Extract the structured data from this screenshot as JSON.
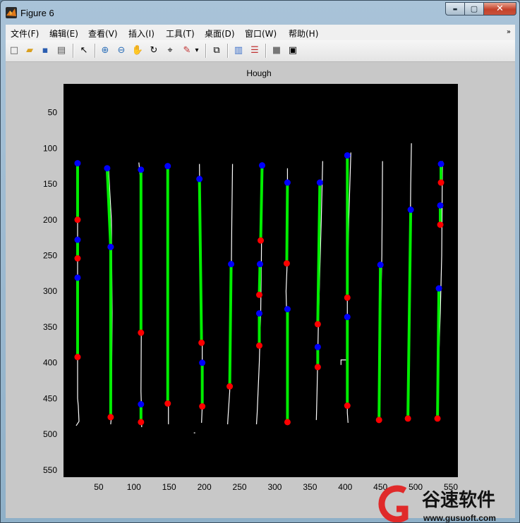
{
  "window": {
    "title": "Figure 6"
  },
  "title_controls": {
    "minimize": "▬",
    "maximize": "▢",
    "close": "✕"
  },
  "menus": [
    {
      "label": "文件(F)"
    },
    {
      "label": "编辑(E)"
    },
    {
      "label": "查看(V)"
    },
    {
      "label": "插入(I)"
    },
    {
      "label": "工具(T)"
    },
    {
      "label": "桌面(D)"
    },
    {
      "label": "窗口(W)"
    },
    {
      "label": "帮助(H)"
    }
  ],
  "menu_overflow": "»",
  "toolbar": [
    {
      "icon": "new-figure-icon",
      "glyph": "□",
      "color": "#555555"
    },
    {
      "icon": "open-file-icon",
      "glyph": "▰",
      "color": "#d9a020"
    },
    {
      "icon": "save-icon",
      "glyph": "▪",
      "color": "#2a5db0"
    },
    {
      "icon": "print-icon",
      "glyph": "▤",
      "color": "#555555"
    },
    {
      "icon": "edit-plot-arrow-icon",
      "glyph": "↖",
      "color": "#000000"
    },
    {
      "icon": "zoom-in-icon",
      "glyph": "⊕",
      "color": "#2c6fb8"
    },
    {
      "icon": "zoom-out-icon",
      "glyph": "⊖",
      "color": "#2c6fb8"
    },
    {
      "icon": "pan-hand-icon",
      "glyph": "✋",
      "color": "#b07a3a"
    },
    {
      "icon": "rotate-3d-icon",
      "glyph": "↻",
      "color": "#333333"
    },
    {
      "icon": "data-cursor-icon",
      "glyph": "⌖",
      "color": "#333333"
    },
    {
      "icon": "brush-icon",
      "glyph": "✎",
      "color": "#c03030"
    },
    {
      "icon": "brush-dropdown-icon",
      "glyph": "▾",
      "color": "#000000"
    },
    {
      "icon": "link-plot-icon",
      "glyph": "⧉",
      "color": "#333333"
    },
    {
      "icon": "colorbar-icon",
      "glyph": "▥",
      "color": "#3a6ec8"
    },
    {
      "icon": "legend-icon",
      "glyph": "☰",
      "color": "#c03030"
    },
    {
      "icon": "hide-plot-tools-icon",
      "glyph": "■",
      "color": "#777777"
    },
    {
      "icon": "show-plot-tools-icon",
      "glyph": "▣",
      "color": "#333333"
    }
  ],
  "chart_data": {
    "type": "scatter",
    "title": "Hough",
    "xlabel": "",
    "ylabel": "",
    "xlim": [
      0,
      560
    ],
    "ylim": [
      560,
      10
    ],
    "y_reversed": true,
    "xticks": [
      50,
      100,
      150,
      200,
      250,
      300,
      350,
      400,
      450,
      500,
      550
    ],
    "yticks": [
      50,
      100,
      150,
      200,
      250,
      300,
      350,
      400,
      450,
      500,
      550
    ],
    "background": "#000000",
    "colors": {
      "line": "#00ee00",
      "start": "#0000ff",
      "end": "#ff0000",
      "edges": "#ffffff"
    },
    "segments": [
      {
        "x1": 20,
        "y1": 121,
        "x2": 20,
        "y2": 200
      },
      {
        "x1": 20,
        "y1": 228,
        "x2": 20,
        "y2": 254
      },
      {
        "x1": 20,
        "y1": 281,
        "x2": 20,
        "y2": 392
      },
      {
        "x1": 62,
        "y1": 128,
        "x2": 67,
        "y2": 238
      },
      {
        "x1": 67,
        "y1": 238,
        "x2": 67,
        "y2": 476
      },
      {
        "x1": 110,
        "y1": 130,
        "x2": 110,
        "y2": 358
      },
      {
        "x1": 110,
        "y1": 458,
        "x2": 110,
        "y2": 483
      },
      {
        "x1": 148,
        "y1": 125,
        "x2": 148,
        "y2": 457
      },
      {
        "x1": 193,
        "y1": 143,
        "x2": 196,
        "y2": 372
      },
      {
        "x1": 197,
        "y1": 400,
        "x2": 197,
        "y2": 461
      },
      {
        "x1": 238,
        "y1": 262,
        "x2": 236,
        "y2": 433
      },
      {
        "x1": 282,
        "y1": 124,
        "x2": 280,
        "y2": 229
      },
      {
        "x1": 279,
        "y1": 262,
        "x2": 278,
        "y2": 305
      },
      {
        "x1": 278,
        "y1": 331,
        "x2": 278,
        "y2": 376
      },
      {
        "x1": 318,
        "y1": 148,
        "x2": 317,
        "y2": 261
      },
      {
        "x1": 318,
        "y1": 325,
        "x2": 318,
        "y2": 483
      },
      {
        "x1": 364,
        "y1": 148,
        "x2": 361,
        "y2": 346
      },
      {
        "x1": 361,
        "y1": 378,
        "x2": 361,
        "y2": 406
      },
      {
        "x1": 403,
        "y1": 110,
        "x2": 403,
        "y2": 309
      },
      {
        "x1": 403,
        "y1": 336,
        "x2": 403,
        "y2": 460
      },
      {
        "x1": 450,
        "y1": 263,
        "x2": 448,
        "y2": 480
      },
      {
        "x1": 493,
        "y1": 186,
        "x2": 489,
        "y2": 478
      },
      {
        "x1": 536,
        "y1": 122,
        "x2": 536,
        "y2": 148
      },
      {
        "x1": 535,
        "y1": 180,
        "x2": 535,
        "y2": 207
      },
      {
        "x1": 533,
        "y1": 296,
        "x2": 531,
        "y2": 478
      }
    ],
    "edges": [
      [
        [
          20,
          118
        ],
        [
          20,
          450
        ],
        [
          21,
          460
        ],
        [
          22,
          482
        ],
        [
          18,
          488
        ]
      ],
      [
        [
          64,
          130
        ],
        [
          68,
          200
        ],
        [
          69,
          330
        ],
        [
          68,
          476
        ],
        [
          67,
          486
        ]
      ],
      [
        [
          107,
          120
        ],
        [
          110,
          150
        ],
        [
          111,
          260
        ],
        [
          110,
          440
        ],
        [
          111,
          476
        ],
        [
          111,
          490
        ]
      ],
      [
        [
          148,
          122
        ],
        [
          149,
          260
        ],
        [
          149,
          400
        ],
        [
          149,
          470
        ],
        [
          149,
          486
        ]
      ],
      [
        [
          193,
          122
        ],
        [
          194,
          200
        ],
        [
          195,
          300
        ],
        [
          197,
          360
        ],
        [
          197,
          460
        ],
        [
          196,
          484
        ]
      ],
      [
        [
          240,
          122
        ],
        [
          239,
          200
        ],
        [
          238,
          300
        ],
        [
          236,
          440
        ],
        [
          234,
          470
        ],
        [
          233,
          486
        ]
      ],
      [
        [
          282,
          120
        ],
        [
          281,
          250
        ],
        [
          280,
          330
        ],
        [
          278,
          400
        ],
        [
          275,
          470
        ],
        [
          274,
          486
        ]
      ],
      [
        [
          318,
          128
        ],
        [
          318,
          250
        ],
        [
          316,
          300
        ],
        [
          318,
          380
        ],
        [
          318,
          470
        ],
        [
          317,
          486
        ]
      ],
      [
        [
          368,
          118
        ],
        [
          366,
          200
        ],
        [
          362,
          340
        ],
        [
          360,
          440
        ],
        [
          359,
          480
        ]
      ],
      [
        [
          408,
          106
        ],
        [
          405,
          200
        ],
        [
          403,
          300
        ],
        [
          403,
          380
        ],
        [
          403,
          470
        ],
        [
          404,
          484
        ]
      ],
      [
        [
          453,
          118
        ],
        [
          452,
          250
        ],
        [
          450,
          350
        ],
        [
          448,
          440
        ],
        [
          447,
          480
        ]
      ],
      [
        [
          494,
          93
        ],
        [
          493,
          150
        ],
        [
          492,
          250
        ],
        [
          491,
          360
        ],
        [
          490,
          476
        ]
      ],
      [
        [
          538,
          118
        ],
        [
          537,
          250
        ],
        [
          535,
          330
        ],
        [
          532,
          420
        ],
        [
          531,
          480
        ]
      ]
    ],
    "extra_edges": [
      [
        [
          394,
          403
        ],
        [
          394,
          396
        ],
        [
          402,
          396
        ]
      ],
      [
        [
          185,
          498
        ],
        [
          187,
          498
        ]
      ]
    ]
  },
  "watermark": {
    "text": "谷速软件",
    "url": "www.gusuoft.com"
  }
}
